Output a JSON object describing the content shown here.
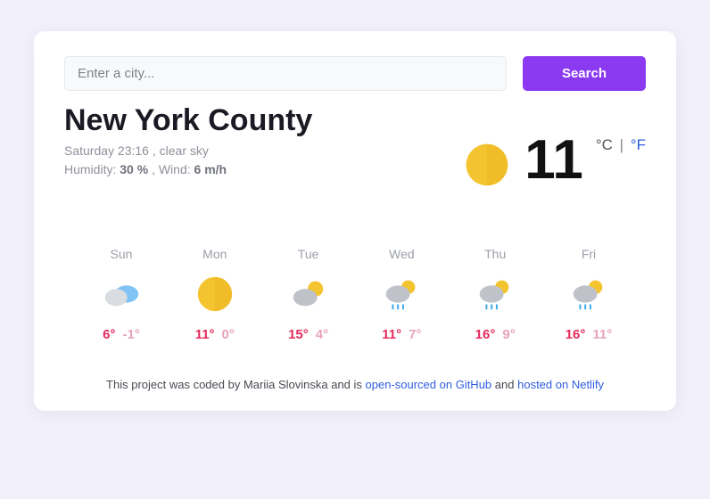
{
  "search": {
    "placeholder": "Enter a city...",
    "button": "Search"
  },
  "city": "New York County",
  "meta": {
    "datetime": "Saturday 23:16",
    "condition": "clear sky",
    "humidity_label": "Humidity:",
    "humidity": "30 %",
    "wind_label": "Wind:",
    "wind": "6 m/h"
  },
  "now": {
    "temp": "11",
    "unit_c": "°C",
    "sep": "|",
    "unit_f": "°F",
    "icon": "clear"
  },
  "forecast": [
    {
      "day": "Sun",
      "icon": "cloud-blue",
      "hi": "6°",
      "lo": "-1°"
    },
    {
      "day": "Mon",
      "icon": "clear",
      "hi": "11°",
      "lo": "0°"
    },
    {
      "day": "Tue",
      "icon": "partly",
      "hi": "15°",
      "lo": "4°"
    },
    {
      "day": "Wed",
      "icon": "rain",
      "hi": "11°",
      "lo": "7°"
    },
    {
      "day": "Thu",
      "icon": "rain",
      "hi": "16°",
      "lo": "9°"
    },
    {
      "day": "Fri",
      "icon": "rain",
      "hi": "16°",
      "lo": "11°"
    }
  ],
  "footer": {
    "pre": "This project was coded by Mariia Slovinska and is ",
    "link1": "open-sourced on GitHub",
    "mid": " and ",
    "link2": "hosted on Netlify"
  }
}
